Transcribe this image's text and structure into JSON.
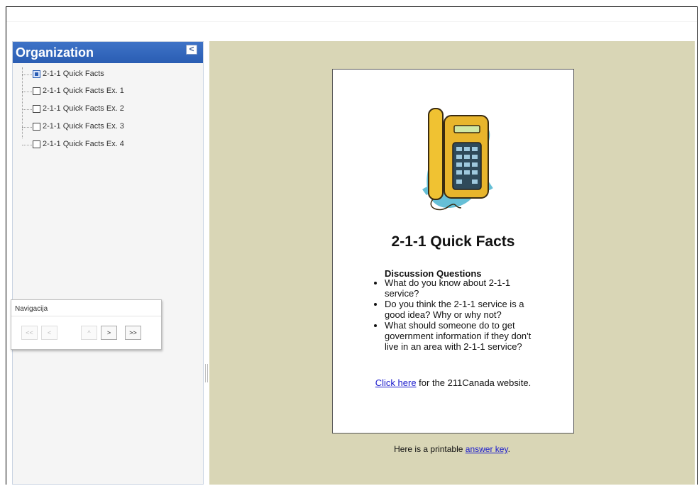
{
  "sidebar": {
    "title": "Organization",
    "collapse_glyph": "<",
    "items": [
      {
        "label": "2-1-1 Quick Facts",
        "active": true
      },
      {
        "label": "2-1-1 Quick Facts Ex. 1",
        "active": false
      },
      {
        "label": "2-1-1 Quick Facts Ex. 2",
        "active": false
      },
      {
        "label": "2-1-1 Quick Facts Ex. 3",
        "active": false
      },
      {
        "label": "2-1-1 Quick Facts Ex. 4",
        "active": false
      }
    ]
  },
  "navigation": {
    "title": "Navigacija",
    "buttons": [
      {
        "label": "<<",
        "enabled": false
      },
      {
        "label": "<",
        "enabled": false
      },
      {
        "label": "^",
        "enabled": false
      },
      {
        "label": ">",
        "enabled": true
      },
      {
        "label": ">>",
        "enabled": true
      }
    ]
  },
  "content": {
    "title": "2-1-1 Quick Facts",
    "questions_heading": "Discussion Questions",
    "questions": [
      "What do you know about 2-1-1 service?",
      "Do you think the 2-1-1 service is a good idea? Why or why not?",
      "What should someone do to get government information if they don't live in an area with 2-1-1 service?"
    ],
    "link_text": "Click here",
    "link_suffix": " for the 211Canada website.",
    "answer_prefix": "Here is a printable ",
    "answer_link": "answer key",
    "answer_suffix": "."
  },
  "colors": {
    "header_blue": "#2a5db3",
    "content_bg": "#d9d6b6",
    "link": "#1a1acc"
  },
  "icons": [
    "collapse-panel-icon",
    "telephone-illustration"
  ]
}
